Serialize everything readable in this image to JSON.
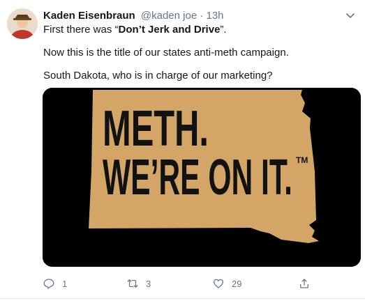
{
  "tweet": {
    "author_name": "Kaden Eisenbraun",
    "author_handle_time": "@kaden joe · 13h",
    "line1": [
      "First there was “",
      "Don’t Jerk and Drive",
      "”."
    ],
    "line2": "Now this is the title of our states anti-meth campaign.",
    "line3": "South Dakota, who is in charge of our marketing?",
    "media": {
      "line_a": "METH.",
      "line_b": "WE’RE ON IT.",
      "tm": "TM",
      "bg_color": "#000000",
      "shape_color": "#d3a567",
      "text_color": "#121212"
    },
    "actions": {
      "reply_count": "1",
      "retweet_count": "3",
      "like_count": "29"
    }
  }
}
